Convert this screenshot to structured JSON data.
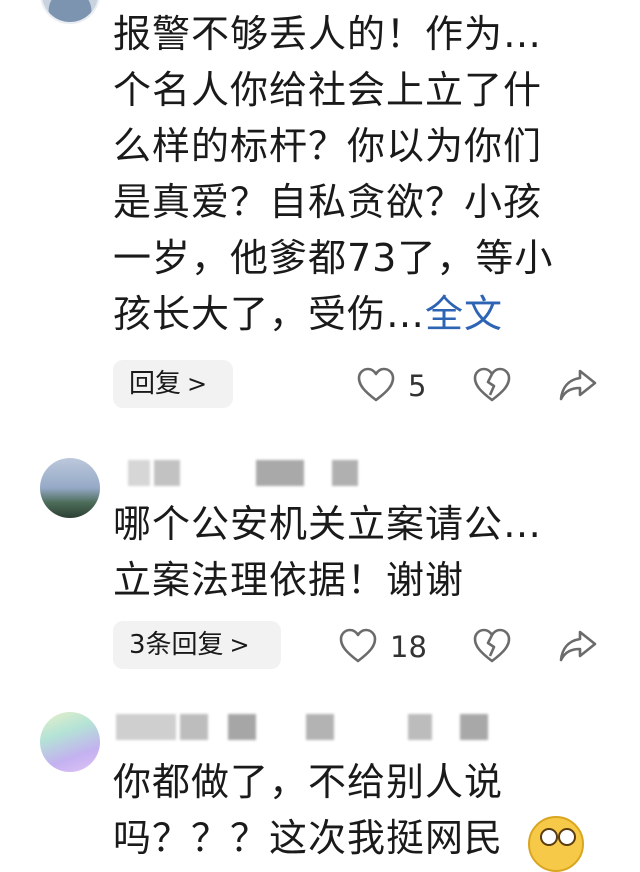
{
  "comments": [
    {
      "text_lines": [
        "报警不够丢人的！作为…",
        "个名人你给社会上立了什",
        "么样的标杆？你以为你们",
        "是真爱？自私贪欲？小孩",
        "一岁，他爹都73了，等小",
        "孩长大了，受伤…"
      ],
      "full_text_label": "全文",
      "reply_label": "回复",
      "reply_chevron": ">",
      "like_count": "5"
    },
    {
      "text_lines": [
        "哪个公安机关立案请公…",
        "立案法理依据！谢谢"
      ],
      "reply_label": "3条回复",
      "reply_chevron": ">",
      "like_count": "18"
    },
    {
      "text_lines": [
        "你都做了，不给别人说",
        "吗？？？这次我挺网民"
      ]
    }
  ],
  "icons": {
    "like": "heart-outline-icon",
    "dislike": "broken-heart-icon",
    "share": "share-arrow-icon",
    "emoji": "laughing-emoji-icon"
  },
  "colors": {
    "link": "#2d64b3",
    "reply_bg": "#f2f2f2",
    "icon": "#6b6b6b"
  }
}
